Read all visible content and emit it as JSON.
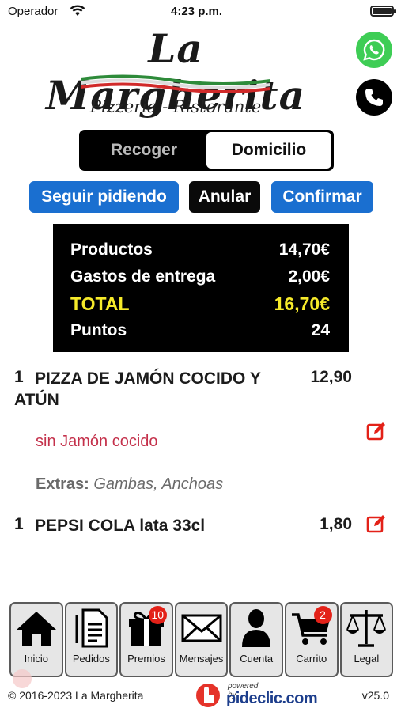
{
  "status_bar": {
    "carrier": "Operador",
    "time": "4:23 p.m."
  },
  "header": {
    "restaurant_name": "La Margherita",
    "subtitle": "Pizzeria - Ristorante",
    "icons": [
      "whatsapp-icon",
      "phone-icon"
    ]
  },
  "delivery_mode": {
    "options": [
      "Recoger",
      "Domicilio"
    ],
    "selected": "Domicilio"
  },
  "actions": {
    "continue_label": "Seguir pidiendo",
    "cancel_label": "Anular",
    "confirm_label": "Confirmar"
  },
  "summary": {
    "rows": [
      {
        "label": "Productos",
        "value": "14,70€"
      },
      {
        "label": "Gastos de entrega",
        "value": "2,00€"
      },
      {
        "label": "TOTAL",
        "value": "16,70€"
      },
      {
        "label": "Puntos",
        "value": "24"
      }
    ]
  },
  "cart": {
    "items": [
      {
        "qty": "1",
        "name": "PIZZA DE JAMÓN COCIDO Y ATÚN",
        "price": "12,90",
        "modifier": "sin Jamón cocido",
        "extras_label": "Extras:",
        "extras": "Gambas, Anchoas"
      },
      {
        "qty": "1",
        "name": "PEPSI COLA lata 33cl",
        "price": "1,80"
      }
    ]
  },
  "nav": {
    "tabs": [
      {
        "label": "Inicio",
        "icon": "home-icon"
      },
      {
        "label": "Pedidos",
        "icon": "document-icon"
      },
      {
        "label": "Premios",
        "icon": "gift-icon",
        "badge": "10"
      },
      {
        "label": "Mensajes",
        "icon": "envelope-icon"
      },
      {
        "label": "Cuenta",
        "icon": "user-icon"
      },
      {
        "label": "Carrito",
        "icon": "cart-icon",
        "badge": "2"
      },
      {
        "label": "Legal",
        "icon": "scales-icon"
      }
    ]
  },
  "footer": {
    "copyright": "© 2016-2023  La Margherita",
    "powered_by": "powered by",
    "brand": "pideclic.com",
    "version": "v25.0"
  },
  "colors": {
    "accent_blue": "#1a6fd0",
    "total_yellow": "#f6ea2a",
    "modifier_red": "#c4314b",
    "edit_red": "#e32118",
    "badge_red": "#e32118",
    "whatsapp_green": "#3ecd55"
  }
}
